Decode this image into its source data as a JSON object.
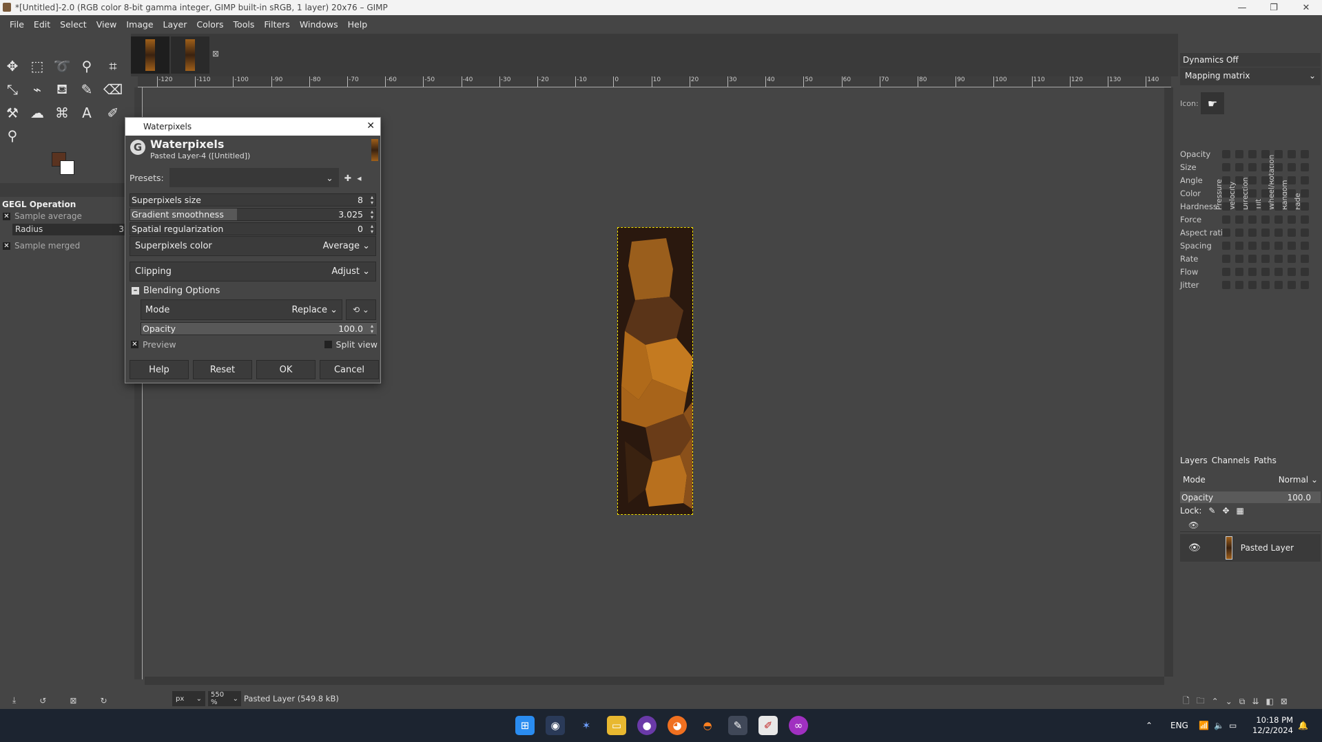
{
  "window": {
    "title": "*[Untitled]-2.0 (RGB color 8-bit gamma integer, GIMP built-in sRGB, 1 layer) 20x76 – GIMP",
    "minimize": "—",
    "maximize": "❐",
    "close": "✕"
  },
  "menu": [
    "File",
    "Edit",
    "Select",
    "View",
    "Image",
    "Layer",
    "Colors",
    "Tools",
    "Filters",
    "Windows",
    "Help"
  ],
  "tool_options": {
    "title": "GEGL Operation",
    "sample_average": "Sample average",
    "radius_label": "Radius",
    "radius_value": "3",
    "sample_merged": "Sample merged"
  },
  "ruler_labels": [
    "-120",
    "-110",
    "-100",
    "-90",
    "-80",
    "-70",
    "-60",
    "-50",
    "-40",
    "-30",
    "-20",
    "-10",
    "0",
    "10",
    "20",
    "30",
    "40",
    "50",
    "60",
    "70",
    "80",
    "90",
    "100",
    "110",
    "120",
    "130",
    "140"
  ],
  "dialog": {
    "window_title": "Waterpixels",
    "header_title": "Waterpixels",
    "header_sub": "Pasted Layer-4 ([Untitled])",
    "presets_label": "Presets:",
    "superpixels_size_label": "Superpixels size",
    "superpixels_size_value": "8",
    "gradient_smoothness_label": "Gradient smoothness",
    "gradient_smoothness_value": "3.025",
    "spatial_regularization_label": "Spatial regularization",
    "spatial_regularization_value": "0",
    "superpixels_color_label": "Superpixels color",
    "superpixels_color_value": "Average",
    "clipping_label": "Clipping",
    "clipping_value": "Adjust",
    "blending_options": "Blending Options",
    "mode_label": "Mode",
    "mode_value": "Replace",
    "opacity_label": "Opacity",
    "opacity_value": "100.0",
    "preview_label": "Preview",
    "split_view_label": "Split view",
    "help": "Help",
    "reset": "Reset",
    "ok": "OK",
    "cancel": "Cancel"
  },
  "status": {
    "unit": "px",
    "zoom": "550 %",
    "text": "Pasted Layer (549.8 kB)"
  },
  "dock": {
    "dynamics": "Dynamics Off",
    "mapping": "Mapping matrix",
    "icon_label": "Icon:",
    "columns": [
      "Pressure",
      "Velocity",
      "Direction",
      "Tilt",
      "Wheel/Rotation",
      "Random",
      "Fade"
    ],
    "rows": [
      "Opacity",
      "Size",
      "Angle",
      "Color",
      "Hardness",
      "Force",
      "Aspect ratio",
      "Spacing",
      "Rate",
      "Flow",
      "Jitter"
    ],
    "layers_tab": "Layers",
    "channels_tab": "Channels",
    "paths_tab": "Paths",
    "mode_label": "Mode",
    "mode_value": "Normal",
    "opacity_label": "Opacity",
    "opacity_value": "100.0",
    "lock_label": "Lock:",
    "layer_name": "Pasted Layer"
  },
  "taskbar": {
    "lang": "ENG",
    "time": "10:18 PM",
    "date": "12/2/2024"
  }
}
